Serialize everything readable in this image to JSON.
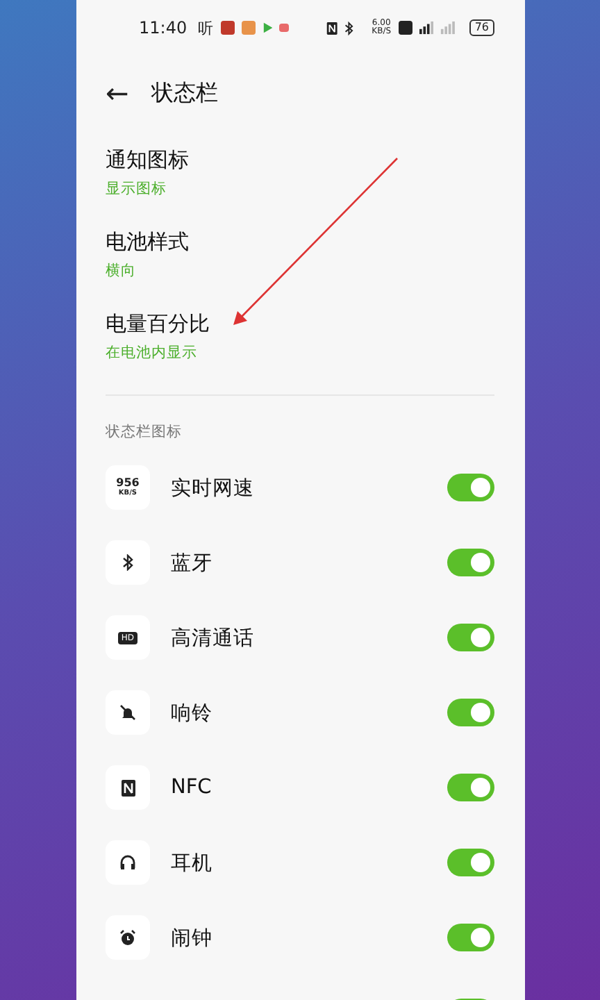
{
  "status_bar": {
    "time": "11:40",
    "app_text": "听",
    "speed_value": "6.00",
    "speed_unit": "KB/S",
    "battery": "76"
  },
  "header": {
    "back": "←",
    "title": "状态栏"
  },
  "settings": [
    {
      "title": "通知图标",
      "value": "显示图标"
    },
    {
      "title": "电池样式",
      "value": "横向"
    },
    {
      "title": "电量百分比",
      "value": "在电池内显示"
    }
  ],
  "section_label": "状态栏图标",
  "icon_rows": [
    {
      "icon_text": [
        "956",
        "KB/S"
      ],
      "label": "实时网速",
      "on": true
    },
    {
      "label": "蓝牙",
      "on": true
    },
    {
      "icon_text": [
        "HD"
      ],
      "label": "高清通话",
      "on": true
    },
    {
      "label": "响铃",
      "on": true
    },
    {
      "label": "NFC",
      "on": true
    },
    {
      "label": "耳机",
      "on": true
    },
    {
      "label": "闹钟",
      "on": true
    },
    {
      "on": true
    }
  ]
}
